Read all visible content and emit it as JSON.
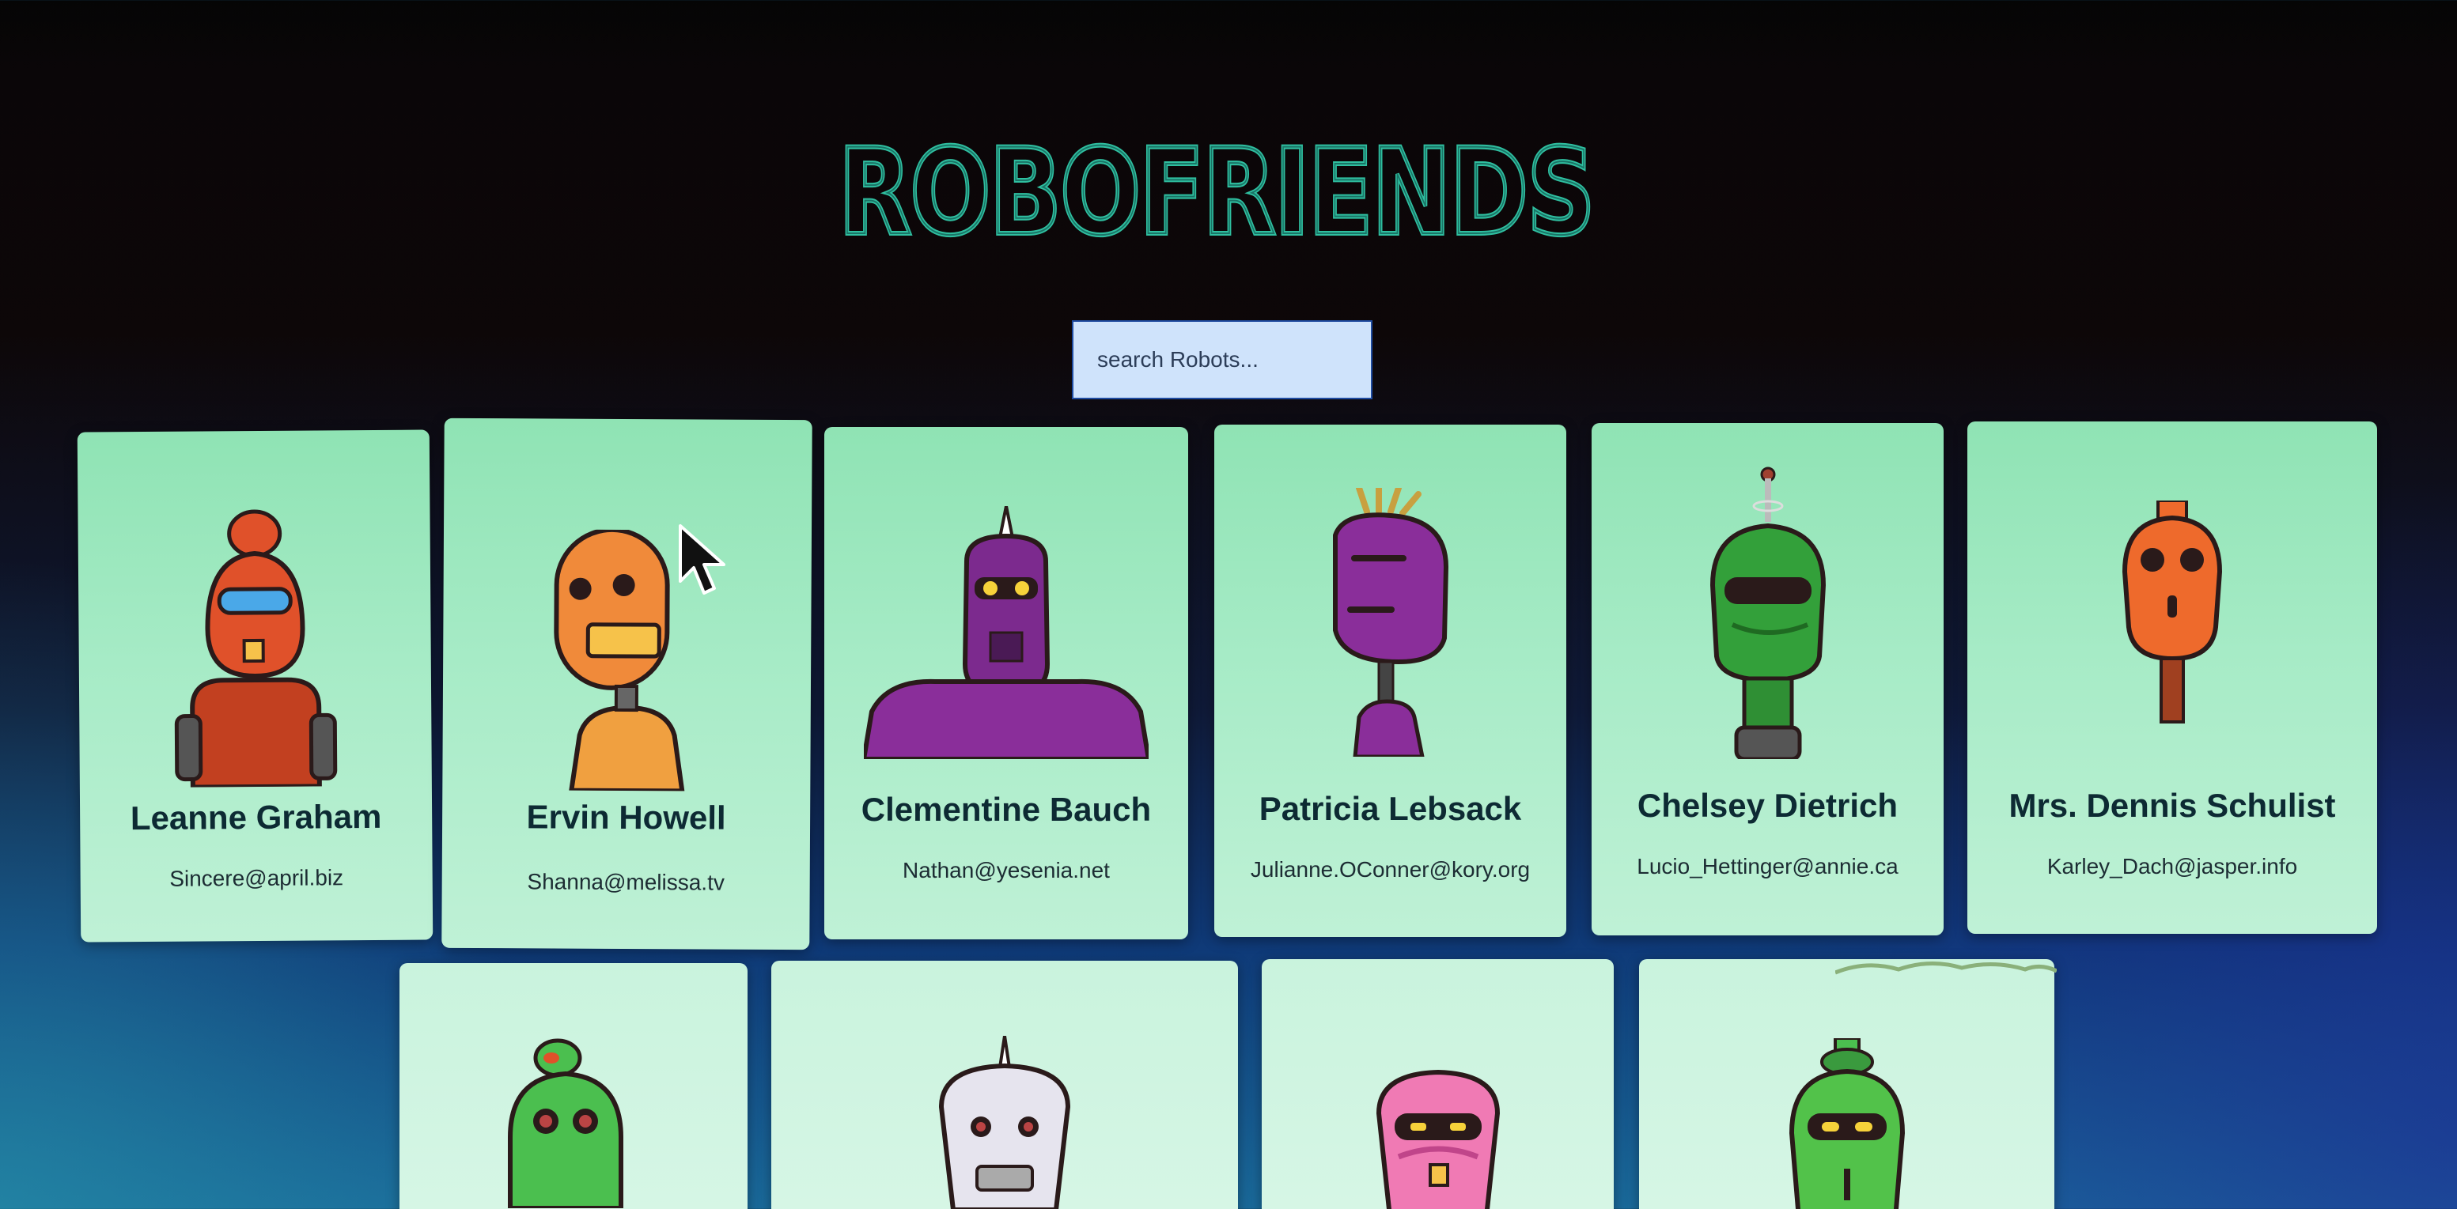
{
  "app": {
    "title": "ROBOFRIENDS"
  },
  "search": {
    "placeholder": "search Robots..."
  },
  "robots": [
    {
      "name": "Leanne Graham",
      "email": "Sincere@april.biz",
      "color": "#e0512a"
    },
    {
      "name": "Ervin Howell",
      "email": "Shanna@melissa.tv",
      "color": "#f08a3a"
    },
    {
      "name": "Clementine Bauch",
      "email": "Nathan@yesenia.net",
      "color": "#7c2a8e"
    },
    {
      "name": "Patricia Lebsack",
      "email": "Julianne.OConner@kory.org",
      "color": "#8a2e9a"
    },
    {
      "name": "Chelsey Dietrich",
      "email": "Lucio_Hettinger@annie.ca",
      "color": "#33a03a"
    },
    {
      "name": "Mrs. Dennis Schulist",
      "email": "Karley_Dach@jasper.info",
      "color": "#ee6a2c"
    },
    {
      "name": "",
      "email": "",
      "color": "#4bbf4f"
    },
    {
      "name": "",
      "email": "",
      "color": "#e6e4ee"
    },
    {
      "name": "",
      "email": "",
      "color": "#f07ab4"
    },
    {
      "name": "",
      "email": "",
      "color": "#52c24a"
    }
  ],
  "colors": {
    "card_bg": "#a6ebc6",
    "logo": "#2fbfa0",
    "search_bg": "#cfe3fb"
  }
}
